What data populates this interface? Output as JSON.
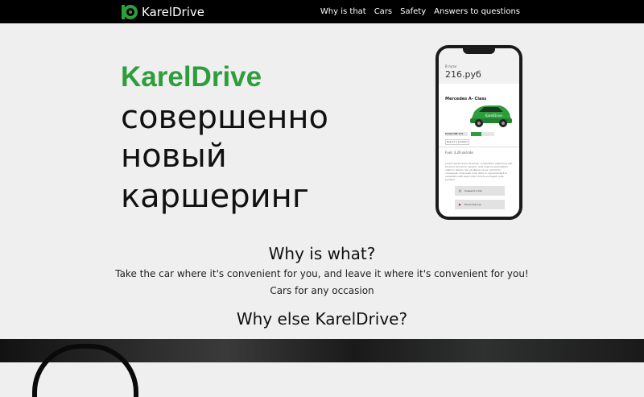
{
  "navbar": {
    "logo_text": "KarelDrive",
    "logo_icon": "wheel-d-icon",
    "links": [
      "Why is that",
      "Cars",
      "Safety",
      "Answers to questions"
    ]
  },
  "hero": {
    "brand": "KarelDrive",
    "lines": [
      "совершенно",
      "новый",
      "каршеринг"
    ],
    "brand_color": "#2e9e3c"
  },
  "phone": {
    "on_the_way": "В пути",
    "price": "216.руб",
    "car_title": "Mercedes A- Class",
    "car_brand": "KarelDrive",
    "plate": "М 000 ММ 174",
    "report": "Report a problem",
    "fuel": "Fuel: 3.20 ok/ride",
    "lorem": "Lorem ipsum dolor sit amet, consectetur adipiscing elit. Ut enim ad minim veniam, quis nostrud exercitation ullamco laboris nisi ut aliquip ex ea commodo consequat. Duis aute irure dolor in reprehenderit in voluptate velit esse cillum dolore eu fugiat nulla pariatur.",
    "suspend": "Suspend a trip",
    "finish": "Finish the trip"
  },
  "section": {
    "title": "Why is what?",
    "text1": "Take the car where it's convenient for you, and leave it where it's convenient for you!",
    "text2": "Cars for any occasion",
    "title2": "Why else KarelDrive?"
  }
}
